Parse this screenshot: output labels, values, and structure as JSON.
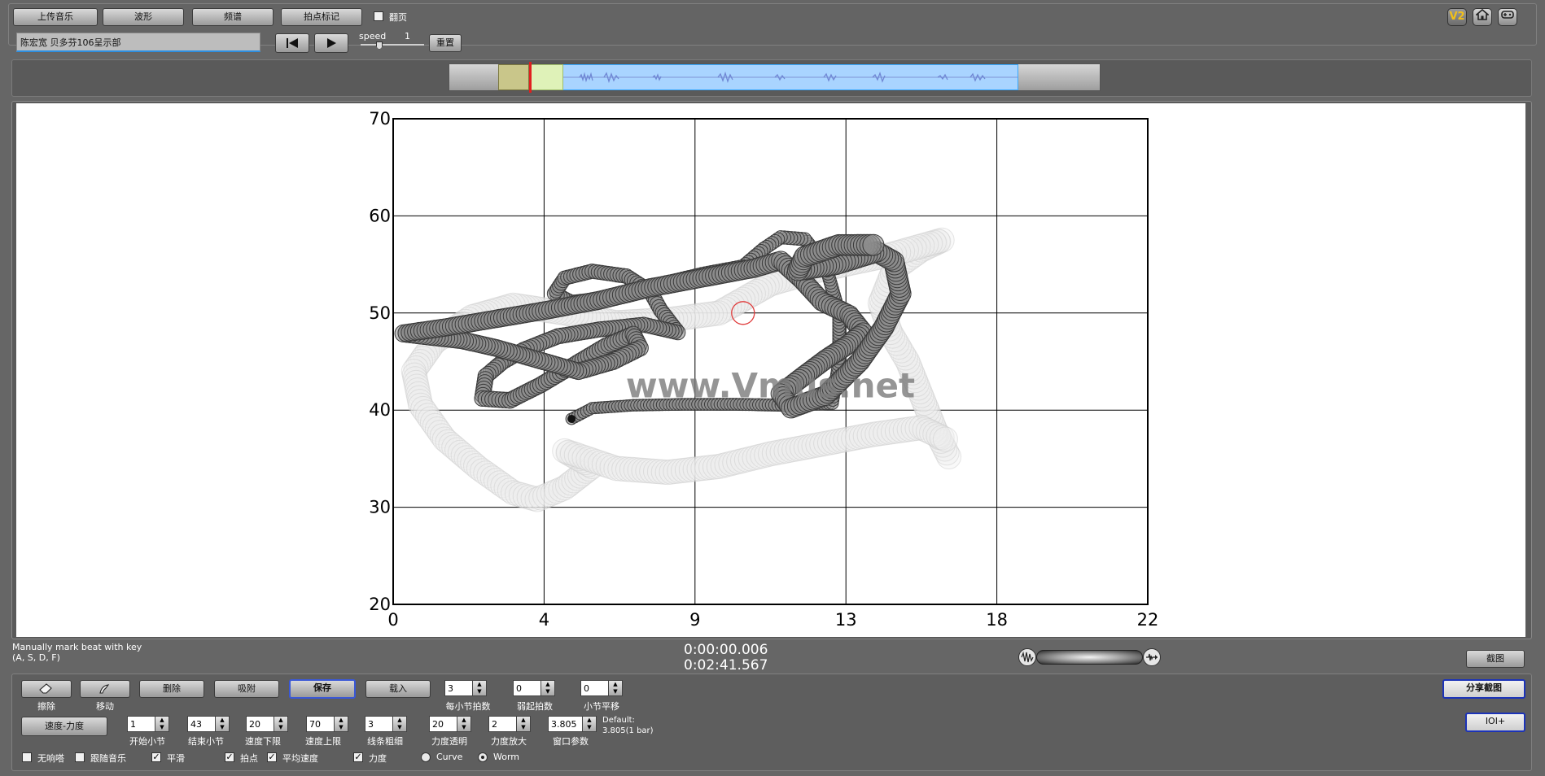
{
  "top_buttons": {
    "upload_music": "上传音乐",
    "waveform": "波形",
    "spectrum": "频谱",
    "beat_mark": "拍点标记",
    "turn_page_label": "翻页"
  },
  "track": {
    "title": "陈宏宽 贝多芬106呈示部"
  },
  "speed": {
    "label": "speed",
    "value": "1",
    "reset_label": "重置"
  },
  "header_icons": [
    "v2-badge-icon",
    "home-icon",
    "gamepad-icon"
  ],
  "v2_badge": "V2",
  "chart_data": {
    "type": "scatter",
    "style": "performance-worm",
    "x_ticks": [
      "0",
      "4",
      "9",
      "13",
      "18",
      "22"
    ],
    "y_ticks": [
      "70",
      "60",
      "50",
      "40",
      "30",
      "20"
    ],
    "xlim": [
      0,
      22
    ],
    "ylim": [
      20,
      70
    ],
    "grid": true,
    "watermark": "www.Vmus.net",
    "worm_path": [
      [
        5.2,
        39.1
      ],
      [
        5.8,
        40.2
      ],
      [
        7.0,
        40.5
      ],
      [
        8.5,
        40.6
      ],
      [
        10.0,
        40.6
      ],
      [
        11.5,
        40.5
      ],
      [
        12.8,
        40.7
      ],
      [
        13.0,
        45.0
      ],
      [
        13.0,
        50.0
      ],
      [
        12.6,
        55.0
      ],
      [
        12.0,
        57.6
      ],
      [
        11.3,
        57.8
      ],
      [
        10.8,
        56.6
      ],
      [
        10.2,
        54.8
      ],
      [
        9.0,
        54.0
      ],
      [
        7.6,
        52.8
      ],
      [
        6.2,
        51.5
      ],
      [
        5.2,
        51.1
      ],
      [
        4.7,
        52.0
      ],
      [
        5.0,
        53.6
      ],
      [
        5.8,
        54.3
      ],
      [
        6.8,
        53.8
      ],
      [
        7.5,
        52.2
      ],
      [
        7.8,
        50.3
      ],
      [
        8.3,
        48.0
      ],
      [
        7.3,
        48.8
      ],
      [
        6.0,
        48.3
      ],
      [
        4.8,
        47.6
      ],
      [
        3.8,
        46.2
      ],
      [
        3.2,
        45.0
      ],
      [
        2.7,
        43.5
      ],
      [
        2.6,
        41.2
      ],
      [
        3.4,
        41.0
      ],
      [
        4.3,
        42.6
      ],
      [
        5.2,
        44.5
      ],
      [
        6.2,
        46.6
      ],
      [
        7.0,
        47.8
      ],
      [
        7.2,
        46.4
      ],
      [
        6.4,
        45.0
      ],
      [
        5.4,
        44.0
      ],
      [
        4.2,
        45.2
      ],
      [
        3.0,
        46.4
      ],
      [
        2.0,
        47.2
      ],
      [
        1.0,
        47.6
      ],
      [
        0.3,
        47.9
      ],
      [
        1.5,
        48.5
      ],
      [
        3.0,
        49.4
      ],
      [
        4.5,
        50.3
      ],
      [
        6.0,
        51.3
      ],
      [
        7.5,
        52.6
      ],
      [
        9.0,
        53.6
      ],
      [
        10.5,
        54.6
      ],
      [
        11.3,
        55.4
      ],
      [
        11.9,
        53.5
      ],
      [
        12.5,
        51.2
      ],
      [
        13.3,
        49.8
      ],
      [
        13.7,
        48.0
      ],
      [
        13.2,
        46.6
      ],
      [
        12.6,
        45.2
      ],
      [
        12.0,
        43.6
      ],
      [
        11.3,
        41.7
      ],
      [
        11.6,
        40.2
      ],
      [
        12.6,
        41.5
      ],
      [
        13.6,
        45.0
      ],
      [
        14.3,
        48.5
      ],
      [
        14.8,
        52.0
      ],
      [
        14.6,
        55.3
      ],
      [
        14.1,
        56.3
      ],
      [
        12.9,
        55.0
      ],
      [
        11.8,
        54.4
      ],
      [
        12.0,
        55.8
      ],
      [
        13.0,
        57.0
      ],
      [
        14.0,
        57.0
      ]
    ],
    "shadow_path": [
      [
        16.2,
        35.2
      ],
      [
        15.8,
        38.0
      ],
      [
        15.4,
        41.5
      ],
      [
        15.0,
        45.0
      ],
      [
        14.5,
        48.0
      ],
      [
        14.2,
        51.0
      ],
      [
        14.6,
        54.5
      ],
      [
        15.4,
        56.5
      ],
      [
        16.0,
        57.5
      ],
      [
        14.5,
        56.0
      ],
      [
        12.5,
        54.5
      ],
      [
        11.0,
        53.0
      ],
      [
        9.5,
        50.0
      ],
      [
        8.0,
        49.3
      ],
      [
        6.5,
        49.0
      ],
      [
        5.0,
        50.0
      ],
      [
        3.5,
        50.8
      ],
      [
        2.3,
        49.6
      ],
      [
        1.2,
        47.0
      ],
      [
        0.6,
        44.0
      ],
      [
        0.8,
        40.5
      ],
      [
        1.5,
        37.0
      ],
      [
        2.5,
        34.0
      ],
      [
        3.5,
        31.5
      ],
      [
        4.2,
        30.8
      ],
      [
        5.0,
        32.0
      ],
      [
        5.8,
        34.2
      ],
      [
        5.0,
        35.8
      ],
      [
        6.5,
        34.0
      ],
      [
        8.0,
        33.6
      ],
      [
        9.5,
        34.2
      ],
      [
        11.0,
        35.5
      ],
      [
        12.5,
        36.5
      ],
      [
        14.0,
        37.5
      ],
      [
        15.4,
        38.2
      ],
      [
        16.1,
        37.0
      ]
    ],
    "cursor_point": [
      10.2,
      50.0
    ]
  },
  "status": {
    "hint_line1": "Manually mark beat with key",
    "hint_line2": "(A, S, D, F)",
    "current_time": "0:00:00.006",
    "total_time": "0:02:41.567",
    "screenshot_label": "截图"
  },
  "tools": {
    "erase": "擦除",
    "move": "移动",
    "delete": "删除",
    "snap": "吸附",
    "save": "保存",
    "load": "载入",
    "tempo_dynamics": "速度-力度",
    "share_screenshot": "分享截图",
    "ioi": "IOI+"
  },
  "params": {
    "beats_per_bar": {
      "value": "3",
      "label": "每小节拍数"
    },
    "pickup_beats": {
      "value": "0",
      "label": "弱起拍数"
    },
    "bar_offset": {
      "value": "0",
      "label": "小节平移"
    },
    "start_bar": {
      "value": "1",
      "label": "开始小节"
    },
    "end_bar": {
      "value": "43",
      "label": "结束小节"
    },
    "tempo_min": {
      "value": "20",
      "label": "速度下限"
    },
    "tempo_max": {
      "value": "70",
      "label": "速度上限"
    },
    "line_width": {
      "value": "3",
      "label": "线条粗细"
    },
    "dyn_transparency": {
      "value": "20",
      "label": "力度透明"
    },
    "dyn_scale": {
      "value": "2",
      "label": "力度放大"
    },
    "window_param": {
      "value": "3.805",
      "label": "窗口参数"
    },
    "default_line1": "Default:",
    "default_line2": "3.805(1 bar)"
  },
  "options": {
    "no_delay": "无响嗒",
    "follow_music": "跟随音乐",
    "smooth": "平滑",
    "beats": "拍点",
    "avg_tempo": "平均速度",
    "dynamics": "力度",
    "curve": "Curve",
    "worm": "Worm"
  }
}
